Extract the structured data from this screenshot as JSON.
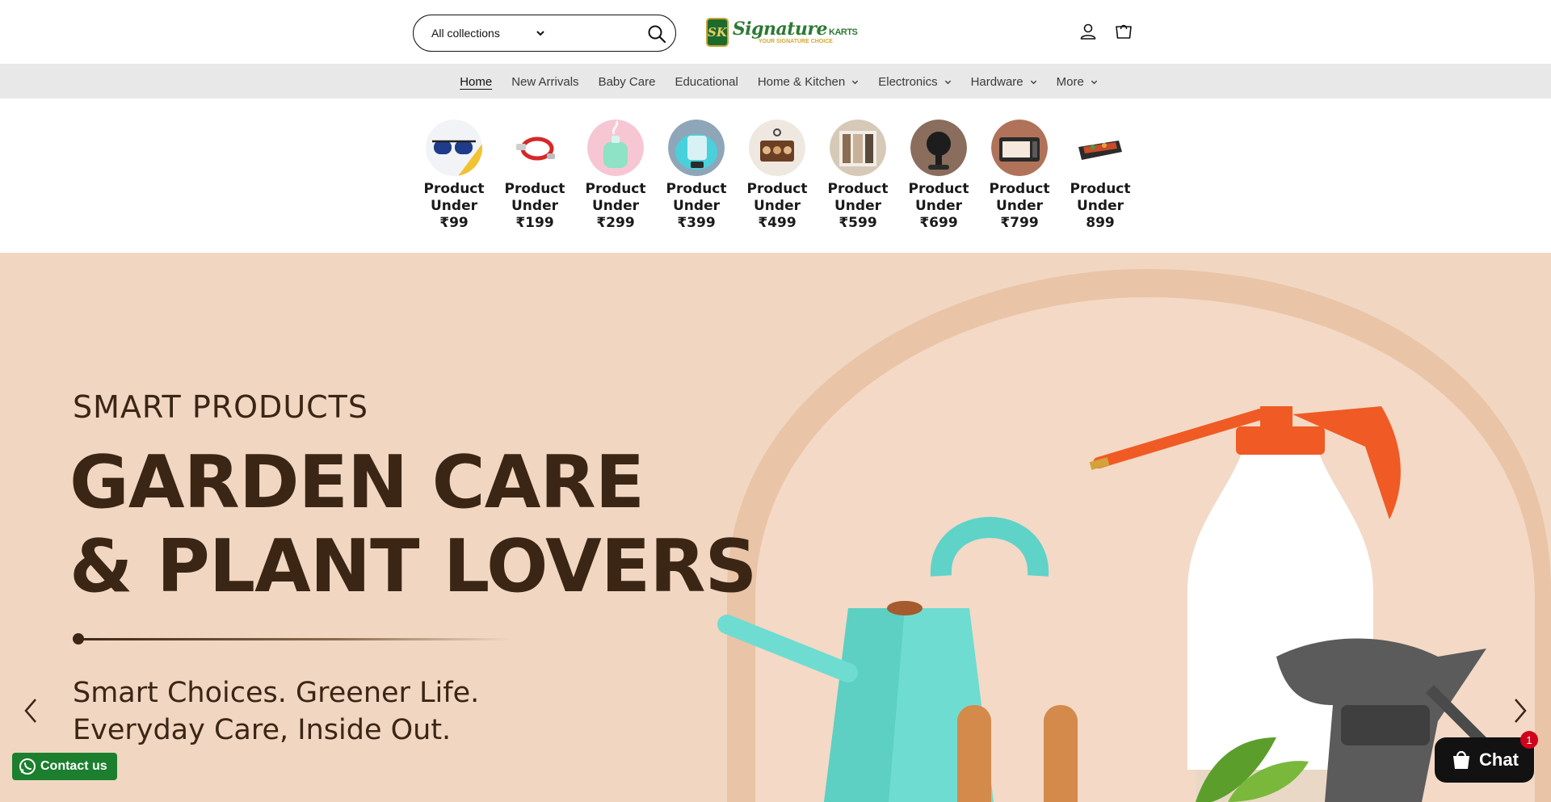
{
  "header": {
    "collections_select": "All collections",
    "search_icon": "search-icon",
    "logo": {
      "mark": "SK",
      "name": "Signature",
      "suffix": "KARTS",
      "tagline": "YOUR SIGNATURE CHOICE"
    },
    "account_icon": "account-icon",
    "cart_icon": "cart-icon"
  },
  "nav": {
    "items": [
      {
        "label": "Home",
        "active": true,
        "dropdown": false
      },
      {
        "label": "New Arrivals",
        "active": false,
        "dropdown": false
      },
      {
        "label": "Baby Care",
        "active": false,
        "dropdown": false
      },
      {
        "label": "Educational",
        "active": false,
        "dropdown": false
      },
      {
        "label": "Home & Kitchen",
        "active": false,
        "dropdown": true
      },
      {
        "label": "Electronics",
        "active": false,
        "dropdown": true
      },
      {
        "label": "Hardware",
        "active": false,
        "dropdown": true
      },
      {
        "label": "More",
        "active": false,
        "dropdown": true
      }
    ]
  },
  "categories": [
    {
      "label": "Product Under ₹99"
    },
    {
      "label": "Product Under ₹199"
    },
    {
      "label": "Product Under ₹299"
    },
    {
      "label": "Product Under ₹399"
    },
    {
      "label": "Product Under ₹499"
    },
    {
      "label": "Product Under ₹599"
    },
    {
      "label": "Product Under ₹699"
    },
    {
      "label": "Product Under ₹799"
    },
    {
      "label": "Product Under 899"
    }
  ],
  "hero": {
    "eyebrow": "SMART PRODUCTS",
    "title_line1": "GARDEN CARE",
    "title_line2": "& PLANT LOVERS",
    "sub_line1": "Smart Choices. Greener Life.",
    "sub_line2": "Everyday Care, Inside Out.",
    "prev_icon": "chevron-left-icon",
    "next_icon": "chevron-right-icon"
  },
  "floaters": {
    "contact_label": "Contact us",
    "chat_label": "Chat",
    "chat_badge": "1"
  },
  "colors": {
    "hero_bg": "#f1d7c2",
    "hero_text": "#3b2616",
    "nav_bg": "#e8e8e8",
    "brand_green": "#2d7a34",
    "whatsapp_green": "#1b7f2e",
    "badge_red": "#d0021b"
  }
}
